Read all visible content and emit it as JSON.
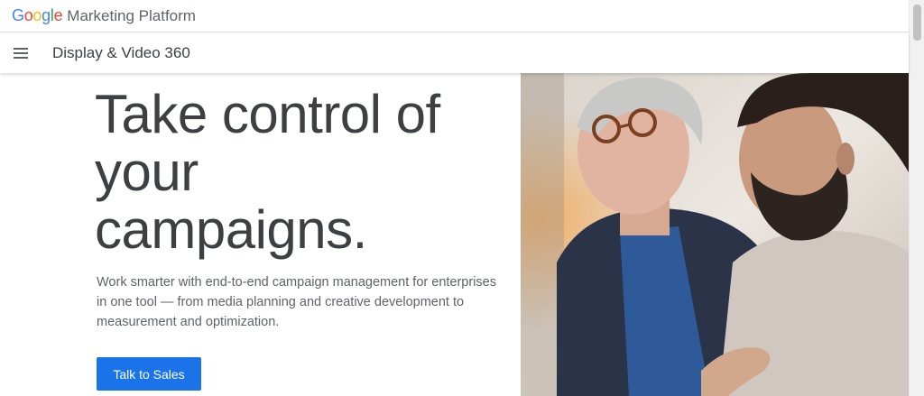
{
  "brand": {
    "google_letters": [
      {
        "char": "G",
        "color": "#4285f4"
      },
      {
        "char": "o",
        "color": "#ea4335"
      },
      {
        "char": "o",
        "color": "#fbbc05"
      },
      {
        "char": "g",
        "color": "#4285f4"
      },
      {
        "char": "l",
        "color": "#34a853"
      },
      {
        "char": "e",
        "color": "#ea4335"
      }
    ],
    "product": "Marketing Platform"
  },
  "nav": {
    "menu_icon": "hamburger-menu-icon",
    "title": "Display & Video 360"
  },
  "hero": {
    "title_line1": "Take control of",
    "title_line2": "your",
    "title_line3": "campaigns.",
    "description": "Work smarter with end-to-end campaign management for enterprises in one tool — from media planning and creative development to measurement and optimization.",
    "cta_label": "Talk to Sales"
  },
  "photo": {
    "subject": "two men looking at a laptop screen"
  },
  "colors": {
    "accent": "#1a73e8",
    "text": "#3c4043",
    "muted": "#5f6368"
  }
}
